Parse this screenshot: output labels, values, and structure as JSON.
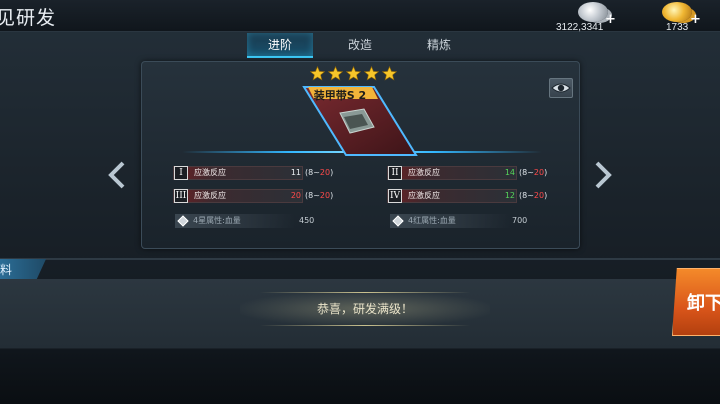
{
  "header": {
    "title": "见研发",
    "currencies": [
      {
        "name": "silver",
        "amount": "3122,3341",
        "icon": "silver-coins-icon"
      },
      {
        "name": "gold",
        "amount": "1733",
        "icon": "gold-coins-icon"
      }
    ],
    "plus": "+"
  },
  "tabs": [
    {
      "label": "进阶",
      "active": true
    },
    {
      "label": "改造",
      "active": false
    },
    {
      "label": "精炼",
      "active": false
    }
  ],
  "item": {
    "name": "装甲带S 2",
    "stars": 5
  },
  "stats": [
    {
      "roman": "I",
      "name": "应激反应",
      "value": "11",
      "value_color": "white",
      "range_low": "8",
      "range_sep": "~",
      "range_high": "20"
    },
    {
      "roman": "II",
      "name": "应激反应",
      "value": "14",
      "value_color": "green",
      "range_low": "8",
      "range_sep": "~",
      "range_high": "20"
    },
    {
      "roman": "III",
      "name": "应激反应",
      "value": "20",
      "value_color": "red",
      "range_low": "8",
      "range_sep": "~",
      "range_high": "20"
    },
    {
      "roman": "IV",
      "name": "应激反应",
      "value": "12",
      "value_color": "green",
      "range_low": "8",
      "range_sep": "~",
      "range_high": "20"
    }
  ],
  "attributes": [
    {
      "name": "4星属性:血量",
      "value": "450"
    },
    {
      "name": "4红属性:血量",
      "value": "700"
    }
  ],
  "material_tab": "料",
  "congrats": "恭喜，研发满级！",
  "unequip_label": "卸下",
  "colors": {
    "accent": "#3fd0ff",
    "star": "#f7c62a",
    "red": "#ff4a4a",
    "green": "#56d45a",
    "button_orange": "#e46a20"
  }
}
